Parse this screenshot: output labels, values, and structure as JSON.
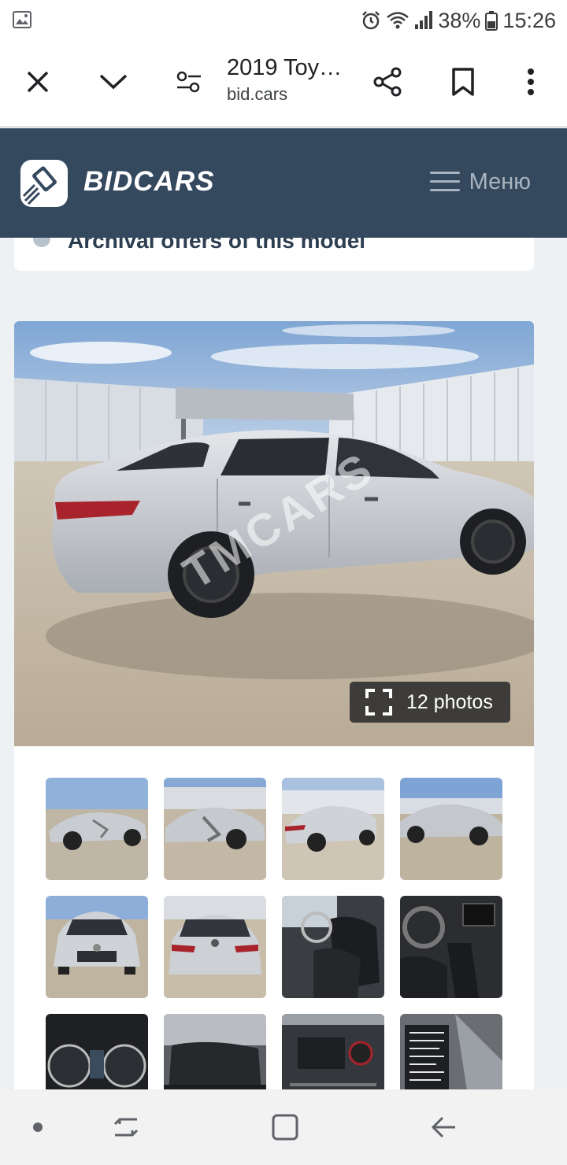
{
  "status_bar": {
    "battery": "38%",
    "time": "15:26"
  },
  "browser": {
    "page_title": "2019 Toy…",
    "domain": "bid.cars"
  },
  "site": {
    "brand": "BIDCARS",
    "menu_label": "Меню"
  },
  "archive": {
    "text": "Archival offers of this model"
  },
  "gallery": {
    "photos_label": "12 photos",
    "watermark": "TMCARS"
  },
  "thumbnails": [
    {
      "name": "side-damage-left"
    },
    {
      "name": "side-damage-close"
    },
    {
      "name": "rear-quarter"
    },
    {
      "name": "side-right"
    },
    {
      "name": "front"
    },
    {
      "name": "rear"
    },
    {
      "name": "driver-seat"
    },
    {
      "name": "dashboard"
    },
    {
      "name": "instrument-cluster"
    },
    {
      "name": "rear-seats"
    },
    {
      "name": "engine-bay"
    },
    {
      "name": "vin-label"
    }
  ],
  "colors": {
    "header_bg": "#34495e",
    "page_bg": "#eef1f4"
  }
}
